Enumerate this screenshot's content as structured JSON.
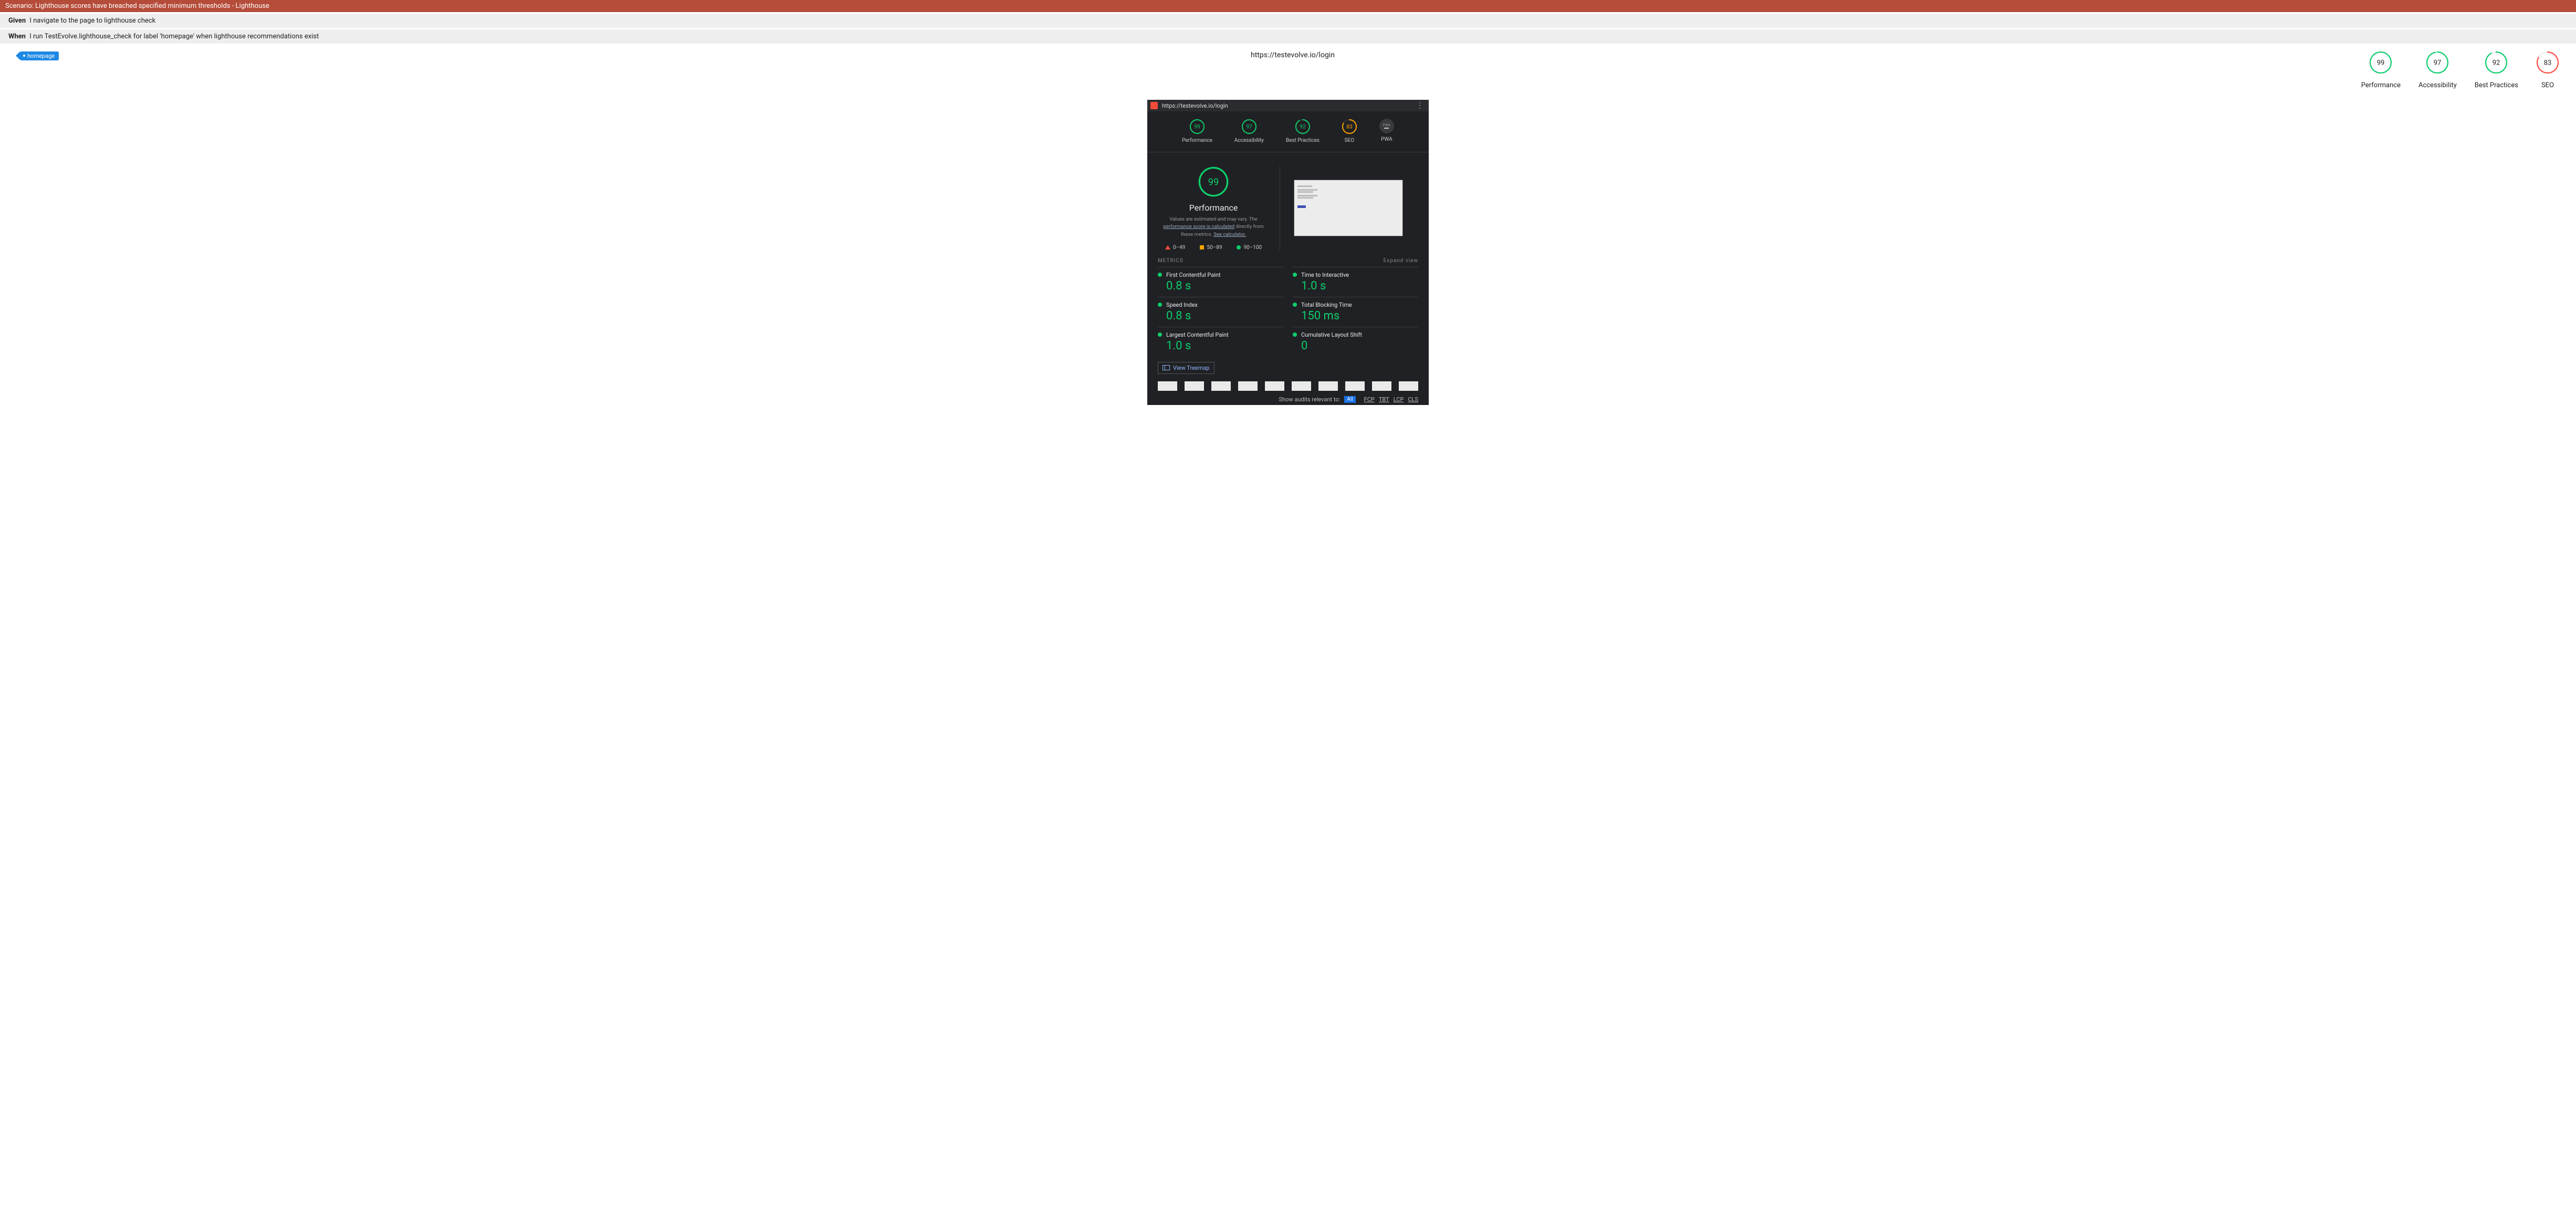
{
  "scenario": {
    "title": "Scenario: Lighthouse scores have breached specified minimum thresholds - Lighthouse"
  },
  "steps": [
    {
      "keyword": "Given",
      "text": "I navigate to the page to lighthouse check"
    },
    {
      "keyword": "When",
      "text": "I run TestEvolve.lighthouse_check for label 'homepage' when lighthouse recommendations exist"
    }
  ],
  "tag": "homepage",
  "url": "https://testevolve.io/login",
  "top_gauges": [
    {
      "score": 99,
      "label": "Performance",
      "color": "#0cce6b"
    },
    {
      "score": 97,
      "label": "Accessibility",
      "color": "#0cce6b"
    },
    {
      "score": 92,
      "label": "Best Practices",
      "color": "#0cce6b"
    },
    {
      "score": 83,
      "label": "SEO",
      "color": "#ff4e42"
    }
  ],
  "report": {
    "url": "https://testevolve.io/login",
    "mini_gauges": [
      {
        "score": 99,
        "label": "Performance",
        "color": "#0cce6b"
      },
      {
        "score": 97,
        "label": "Accessibility",
        "color": "#0cce6b"
      },
      {
        "score": 92,
        "label": "Best Practices",
        "color": "#0cce6b"
      },
      {
        "score": 83,
        "label": "SEO",
        "color": "#ffa400"
      }
    ],
    "pwa_label": "PWA",
    "hero": {
      "score": 99,
      "title": "Performance",
      "disclaimer_pre": "Values are estimated and may vary. The ",
      "link1": "performance score is calculated",
      "disclaimer_mid": " directly from these metrics. ",
      "link2": "See calculator."
    },
    "legend": {
      "r": "0–49",
      "o": "50–89",
      "g": "90–100"
    },
    "metrics_header": "METRICS",
    "expand_view": "Expand view",
    "metrics": [
      {
        "name": "First Contentful Paint",
        "value": "0.8 s"
      },
      {
        "name": "Time to Interactive",
        "value": "1.0 s"
      },
      {
        "name": "Speed Index",
        "value": "0.8 s"
      },
      {
        "name": "Total Blocking Time",
        "value": "150 ms"
      },
      {
        "name": "Largest Contentful Paint",
        "value": "1.0 s"
      },
      {
        "name": "Cumulative Layout Shift",
        "value": "0"
      }
    ],
    "treemap": "View Treemap",
    "audits_label": "Show audits relevant to:",
    "audit_filters": {
      "all": "All",
      "items": [
        "FCP",
        "TBT",
        "LCP",
        "CLS"
      ]
    }
  },
  "chart_data": [
    {
      "type": "bar",
      "title": "Top summary gauges",
      "categories": [
        "Performance",
        "Accessibility",
        "Best Practices",
        "SEO"
      ],
      "values": [
        99,
        97,
        92,
        83
      ],
      "ylim": [
        0,
        100
      ]
    },
    {
      "type": "bar",
      "title": "Lighthouse report gauges",
      "categories": [
        "Performance",
        "Accessibility",
        "Best Practices",
        "SEO"
      ],
      "values": [
        99,
        97,
        92,
        83
      ],
      "ylim": [
        0,
        100
      ]
    },
    {
      "type": "table",
      "title": "Performance metrics",
      "categories": [
        "First Contentful Paint",
        "Time to Interactive",
        "Speed Index",
        "Total Blocking Time",
        "Largest Contentful Paint",
        "Cumulative Layout Shift"
      ],
      "values_display": [
        "0.8 s",
        "1.0 s",
        "0.8 s",
        "150 ms",
        "1.0 s",
        "0"
      ]
    }
  ]
}
